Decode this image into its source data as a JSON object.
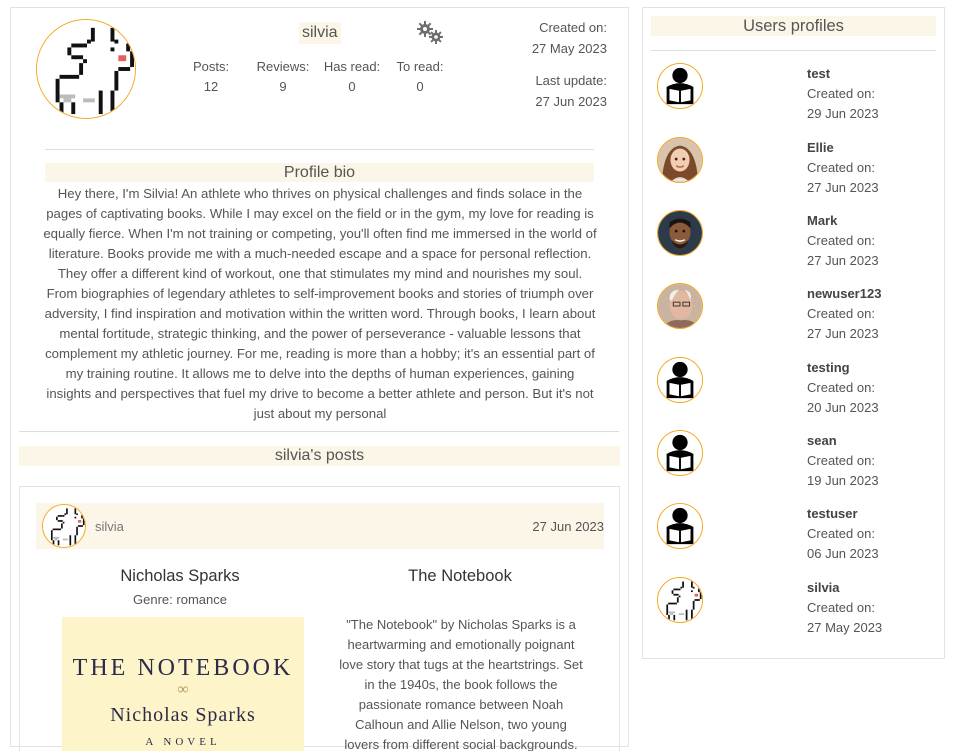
{
  "profile": {
    "username": "silvia",
    "stats": [
      {
        "label": "Posts:",
        "value": "12"
      },
      {
        "label": "Reviews:",
        "value": "9"
      },
      {
        "label": "Has read:",
        "value": "0"
      },
      {
        "label": "To read:",
        "value": "0"
      }
    ],
    "created_label": "Created on:",
    "created_date": "27 May 2023",
    "updated_label": "Last update:",
    "updated_date": "27 Jun 2023",
    "bio_title": "Profile bio",
    "bio_text": "Hey there, I'm Silvia! An athlete who thrives on physical challenges and finds solace in the pages of captivating books. While I may excel on the field or in the gym, my love for reading is equally fierce.  When I'm not training or competing, you'll often find me immersed in the world of literature. Books provide me with a much-needed escape and a space for personal reflection. They offer a different kind of workout, one that stimulates my mind and nourishes my soul.  From biographies of legendary athletes to self-improvement books and stories of triumph over adversity, I find inspiration and motivation within the written word. Through books, I learn about mental fortitude, strategic thinking, and the power of perseverance - valuable lessons that complement my athletic journey.  For me, reading is more than a hobby; it's an essential part of my training routine. It allows me to delve into the depths of human experiences, gaining insights and perspectives that fuel my drive to become a better athlete and person.  But it's not just about my personal"
  },
  "posts_section": {
    "title": "silvia's posts",
    "post": {
      "user": "silvia",
      "date": "27 Jun 2023",
      "author": "Nicholas Sparks",
      "genre": "Genre: romance",
      "title": "The Notebook",
      "cover_title": "THE NOTEBOOK",
      "cover_author": "Nicholas Sparks",
      "cover_subtitle": "A NOVEL",
      "description": "\"The Notebook\" by Nicholas Sparks is a heartwarming and emotionally poignant love story that tugs at the heartstrings. Set in the 1940s, the book follows the passionate romance between Noah Calhoun and Allie Nelson, two young lovers from different social backgrounds."
    }
  },
  "sidebar": {
    "title": "Users profiles",
    "created_label": "Created on:",
    "users": [
      {
        "name": "test",
        "date": "29 Jun 2023",
        "avatar": "reader-icon"
      },
      {
        "name": "Ellie",
        "date": "27 Jun 2023",
        "avatar": "photo-woman"
      },
      {
        "name": "Mark",
        "date": "27 Jun 2023",
        "avatar": "photo-man"
      },
      {
        "name": "newuser123",
        "date": "27 Jun 2023",
        "avatar": "photo-older-man"
      },
      {
        "name": "testing",
        "date": "20 Jun 2023",
        "avatar": "reader-icon"
      },
      {
        "name": "sean",
        "date": "19 Jun 2023",
        "avatar": "reader-icon"
      },
      {
        "name": "testuser",
        "date": "06 Jun 2023",
        "avatar": "reader-icon"
      },
      {
        "name": "silvia",
        "date": "27 May 2023",
        "avatar": "goat-pixel-icon"
      }
    ]
  },
  "colors": {
    "accent_border": "#f5a623",
    "header_bg": "#fbf6e8"
  }
}
